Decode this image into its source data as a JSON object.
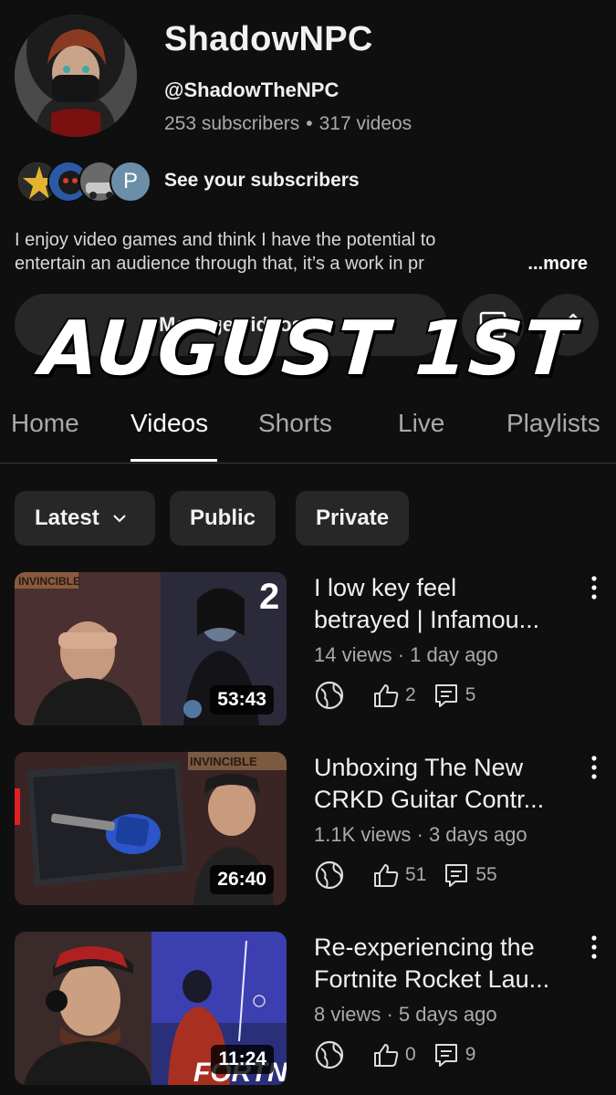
{
  "channel": {
    "name": "ShadowNPC",
    "handle": "@ShadowTheNPC",
    "subscribers": "253 subscribers",
    "videos": "317 videos",
    "see_subscribers": "See your subscribers",
    "subscriber_initial": "P",
    "description_line1": "I enjoy video games and think I have the potential to",
    "description_line2": "entertain an audience through that, it’s a work in pr",
    "more_label": "...more"
  },
  "actions": {
    "manage_videos": "Manage videos",
    "icons": [
      "analytics-icon",
      "pencil-icon"
    ]
  },
  "overlay": {
    "text": "AUGUST 1ST"
  },
  "tabs": [
    {
      "label": "Home",
      "active": false
    },
    {
      "label": "Videos",
      "active": true
    },
    {
      "label": "Shorts",
      "active": false
    },
    {
      "label": "Live",
      "active": false
    },
    {
      "label": "Playlists",
      "active": false
    }
  ],
  "filters": [
    {
      "label": "Latest",
      "has_dropdown": true
    },
    {
      "label": "Public"
    },
    {
      "label": "Private"
    }
  ],
  "videos": [
    {
      "title_line1": "I low key feel",
      "title_line2": "betrayed | Infamou...",
      "views": "14 views",
      "age": "1 day ago",
      "duration": "53:43",
      "likes": "2",
      "comments": "5",
      "thumb_badge": "2",
      "thumb_banner": "INVINCIBLE"
    },
    {
      "title_line1": "Unboxing The New",
      "title_line2": "CRKD Guitar Contr...",
      "views": "1.1K views",
      "age": "3 days ago",
      "duration": "26:40",
      "likes": "51",
      "comments": "55",
      "thumb_banner": "INVINCIBLE"
    },
    {
      "title_line1": "Re-experiencing the",
      "title_line2": "Fortnite Rocket Lau...",
      "views": "8 views",
      "age": "5 days ago",
      "duration": "11:24",
      "likes": "0",
      "comments": "9",
      "thumb_logo": "FORTNITE"
    }
  ],
  "colors": {
    "background": "#0f0f0f",
    "surface": "#272727",
    "text_primary": "#f1f1f1",
    "text_secondary": "#aaaaaa"
  }
}
